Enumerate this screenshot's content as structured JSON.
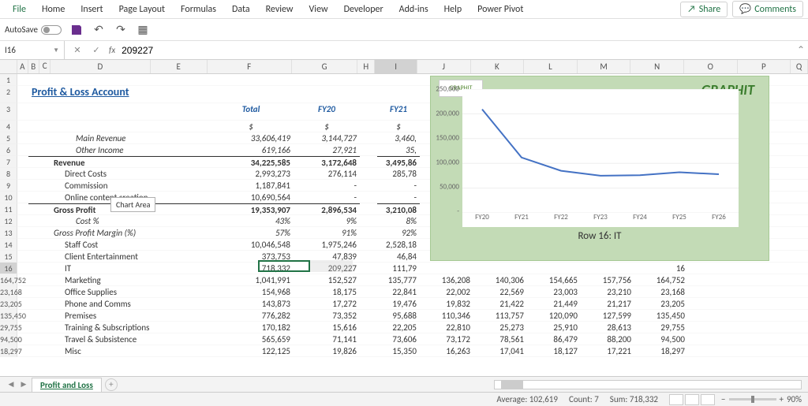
{
  "menu": {
    "tabs": [
      "File",
      "Home",
      "Insert",
      "Page Layout",
      "Formulas",
      "Data",
      "Review",
      "View",
      "Developer",
      "Add-ins",
      "Help",
      "Power Pivot"
    ],
    "share": "Share",
    "comments": "Comments"
  },
  "qat": {
    "autosave": "AutoSave"
  },
  "formula": {
    "cell_ref": "I16",
    "value": "209227"
  },
  "col_headers": [
    "A",
    "B",
    "C",
    "D",
    "E",
    "F",
    "G",
    "H",
    "I",
    "J",
    "K",
    "L",
    "M",
    "N",
    "O",
    "P",
    "Q"
  ],
  "title": "Profit & Loss Account",
  "period_headers": {
    "total": "Total",
    "fy20": "FY20",
    "fy21": "FY21"
  },
  "currency_row": "$",
  "tooltip": "Chart Area",
  "rows": [
    {
      "n": 5,
      "label": "Main Revenue",
      "indent": 2,
      "italic": true,
      "f": "33,606,419",
      "g": "3,144,727",
      "i": "3,460,"
    },
    {
      "n": 6,
      "label": "Other Income",
      "indent": 2,
      "italic": true,
      "f": "619,166",
      "g": "27,921",
      "i": "35,"
    },
    {
      "n": 7,
      "label": "Revenue",
      "indent": 0,
      "bold": true,
      "bt": true,
      "f": "34,225,585",
      "g": "3,172,648",
      "i": "3,495,86"
    },
    {
      "n": 8,
      "label": "Direct Costs",
      "indent": 1,
      "f": "2,993,273",
      "g": "276,114",
      "i": "285,78"
    },
    {
      "n": 9,
      "label": "Commission",
      "indent": 1,
      "f": "1,187,841",
      "g": "-",
      "i": "-"
    },
    {
      "n": 10,
      "label": "Online content creation",
      "indent": 1,
      "f": "10,690,564",
      "g": "-",
      "i": "-"
    },
    {
      "n": 11,
      "label": "Gross Profit",
      "indent": 0,
      "bold": true,
      "bt": true,
      "f": "19,353,907",
      "g": "2,896,534",
      "i": "3,210,08"
    },
    {
      "n": 12,
      "label": "Cost %",
      "indent": 2,
      "italic": true,
      "f": "43%",
      "g": "9%",
      "i": "8%"
    },
    {
      "n": 13,
      "label": "Gross Profit Margin (%)",
      "indent": 0,
      "italic": true,
      "small": true,
      "f": "57%",
      "g": "91%",
      "i": "92%"
    },
    {
      "n": 14,
      "label": "Staff Cost",
      "indent": 1,
      "f": "10,046,548",
      "g": "1,975,246",
      "i": "2,528,18"
    },
    {
      "n": 15,
      "label": "Client Entertainment",
      "indent": 1,
      "f": "373,753",
      "g": "47,839",
      "i": "46,84"
    },
    {
      "n": 16,
      "label": "IT",
      "indent": 1,
      "sel": true,
      "f": "718,332",
      "g": "209,227",
      "i": "111,79"
    },
    {
      "n": "164,752",
      "label": "Marketing",
      "indent": 1,
      "f": "1,041,991",
      "g": "152,527",
      "i": "135,777",
      "j": "136,208",
      "k": "140,306",
      "l": "154,665",
      "m": "157,756"
    },
    {
      "n": "23,168",
      "label": "Office Supplies",
      "indent": 1,
      "f": "154,968",
      "g": "18,175",
      "i": "22,841",
      "j": "22,002",
      "k": "22,569",
      "l": "23,003",
      "m": "23,210"
    },
    {
      "n": "23,205",
      "label": "Phone and Comms",
      "indent": 1,
      "f": "143,873",
      "g": "17,272",
      "i": "19,476",
      "j": "19,832",
      "k": "21,422",
      "l": "21,449",
      "m": "21,217"
    },
    {
      "n": "135,450",
      "label": "Premises",
      "indent": 1,
      "f": "776,282",
      "g": "73,352",
      "i": "95,688",
      "j": "110,346",
      "k": "113,757",
      "l": "120,090",
      "m": "127,599"
    },
    {
      "n": "29,755",
      "label": "Training & Subscriptions",
      "indent": 1,
      "f": "170,182",
      "g": "15,616",
      "i": "22,205",
      "j": "22,810",
      "k": "25,273",
      "l": "25,910",
      "m": "28,613"
    },
    {
      "n": "94,500",
      "label": "Travel & Subsistence",
      "indent": 1,
      "f": "565,659",
      "g": "71,141",
      "i": "73,606",
      "j": "73,172",
      "k": "78,561",
      "l": "86,479",
      "m": "88,200"
    },
    {
      "n": "18,297",
      "label": "Misc",
      "indent": 1,
      "f": "122,125",
      "g": "19,826",
      "i": "15,350",
      "j": "16,263",
      "k": "17,041",
      "l": "18,127",
      "m": "17,221"
    }
  ],
  "sheet_tab": "Profit and Loss",
  "status": {
    "avg": "Average: 102,619",
    "count": "Count: 7",
    "sum": "Sum: 718,332",
    "zoom": "90%"
  },
  "chart_data": {
    "type": "line",
    "title": "GRAPHIT",
    "logo": "GRAPHIT",
    "caption": "Row 16: IT",
    "categories": [
      "FY20",
      "FY21",
      "FY22",
      "FY23",
      "FY24",
      "FY25",
      "FY26"
    ],
    "values": [
      209227,
      111790,
      85000,
      75000,
      76000,
      82000,
      78000
    ],
    "y_ticks": [
      0,
      50000,
      100000,
      150000,
      200000,
      250000
    ],
    "y_tick_labels": [
      "-",
      "50,000",
      "100,000",
      "150,000",
      "200,000",
      "250,000"
    ],
    "ylim": [
      0,
      250000
    ]
  }
}
